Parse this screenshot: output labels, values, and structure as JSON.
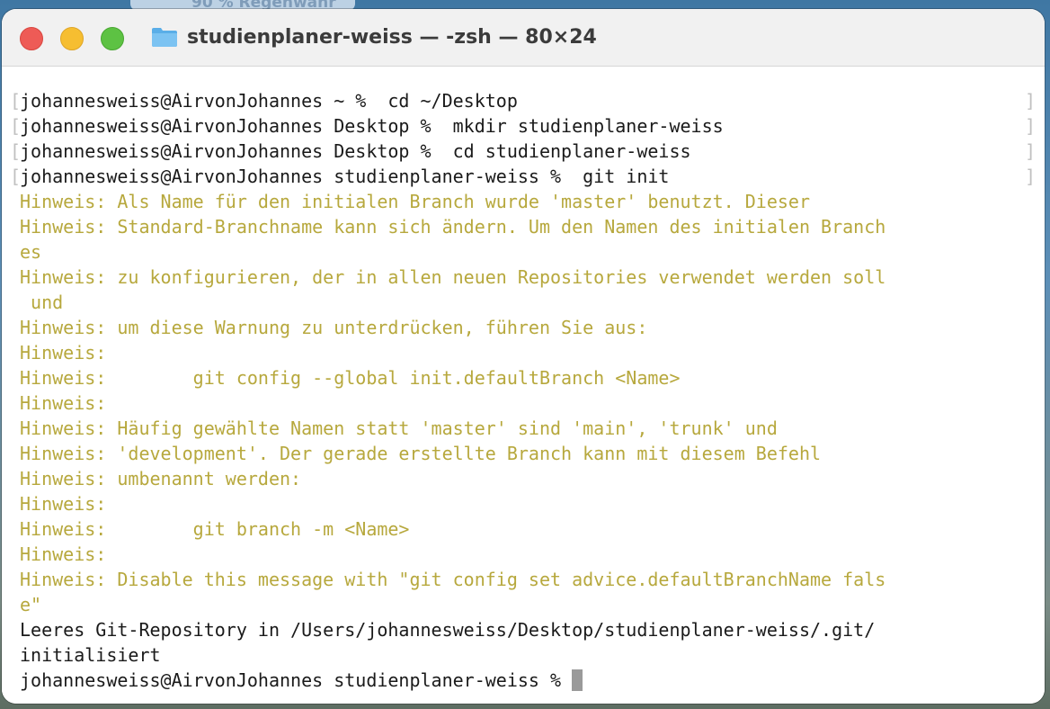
{
  "background": {
    "widget_text": "90 % Regenwahr"
  },
  "window": {
    "title": "studienplaner-weiss — -zsh — 80×24",
    "folder_icon": "folder-icon",
    "colors": {
      "close": "#ee5b56",
      "minimize": "#f6be31",
      "maximize": "#5dc243",
      "hint_text": "#b7a83d",
      "normal_text": "#1a1a1a"
    }
  },
  "terminal": {
    "commands": [
      "johannesweiss@AirvonJohannes ~ %  cd ~/Desktop",
      "johannesweiss@AirvonJohannes Desktop %  mkdir studienplaner-weiss",
      "johannesweiss@AirvonJohannes Desktop %  cd studienplaner-weiss",
      "johannesweiss@AirvonJohannes studienplaner-weiss %  git init"
    ],
    "hints": [
      "Hinweis: Als Name für den initialen Branch wurde 'master' benutzt. Dieser",
      "Hinweis: Standard-Branchname kann sich ändern. Um den Namen des initialen Branch",
      "es",
      "Hinweis: zu konfigurieren, der in allen neuen Repositories verwendet werden soll",
      " und",
      "Hinweis: um diese Warnung zu unterdrücken, führen Sie aus:",
      "Hinweis:",
      "Hinweis:        git config --global init.defaultBranch <Name>",
      "Hinweis:",
      "Hinweis: Häufig gewählte Namen statt 'master' sind 'main', 'trunk' und",
      "Hinweis: 'development'. Der gerade erstellte Branch kann mit diesem Befehl",
      "Hinweis: umbenannt werden:",
      "Hinweis:",
      "Hinweis:        git branch -m <Name>",
      "Hinweis:",
      "Hinweis: Disable this message with \"git config set advice.defaultBranchName fals",
      "e\""
    ],
    "output": [
      "Leeres Git-Repository in /Users/johannesweiss/Desktop/studienplaner-weiss/.git/",
      "initialisiert"
    ],
    "prompt": "johannesweiss@AirvonJohannes studienplaner-weiss % "
  }
}
